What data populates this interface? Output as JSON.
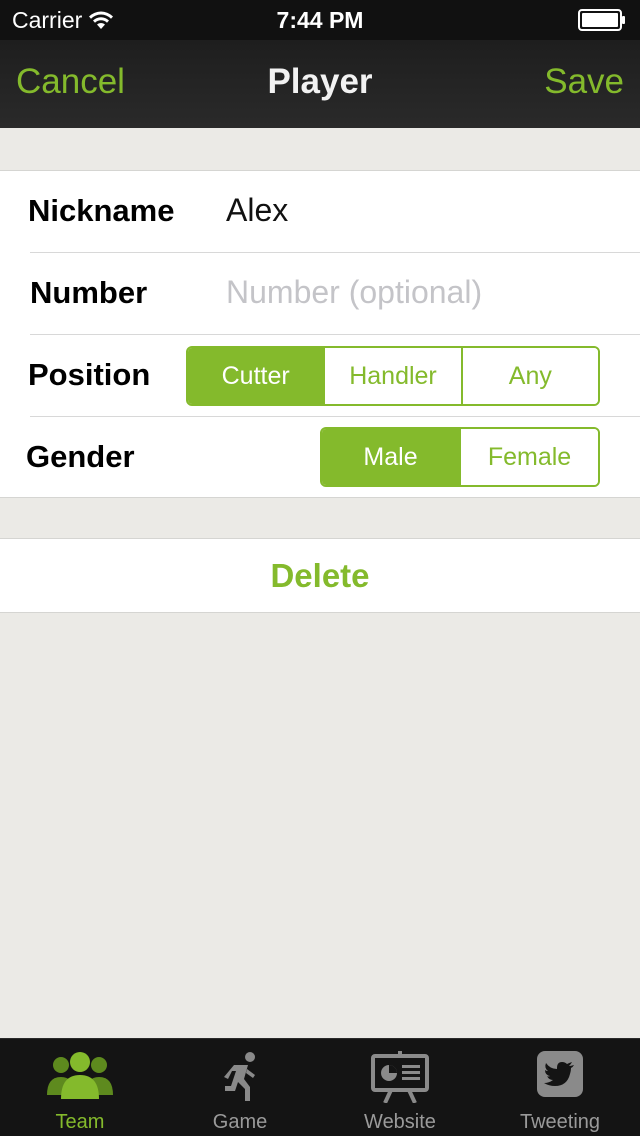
{
  "status": {
    "carrier": "Carrier",
    "time": "7:44 PM"
  },
  "nav": {
    "cancel": "Cancel",
    "title": "Player",
    "save": "Save"
  },
  "form": {
    "nickname_label": "Nickname",
    "nickname_value": "Alex",
    "number_label": "Number",
    "number_placeholder": "Number (optional)",
    "position_label": "Position",
    "position_options": [
      "Cutter",
      "Handler",
      "Any"
    ],
    "position_selected": "Cutter",
    "gender_label": "Gender",
    "gender_options": [
      "Male",
      "Female"
    ],
    "gender_selected": "Male"
  },
  "delete_label": "Delete",
  "tabs": [
    {
      "label": "Team",
      "icon": "team-icon",
      "active": true
    },
    {
      "label": "Game",
      "icon": "runner-icon",
      "active": false
    },
    {
      "label": "Website",
      "icon": "presentation-icon",
      "active": false
    },
    {
      "label": "Tweeting",
      "icon": "twitter-icon",
      "active": false
    }
  ],
  "colors": {
    "accent": "#84ba2c",
    "navbar": "#222222",
    "background": "#ebeae6",
    "tabbar": "#141414"
  }
}
